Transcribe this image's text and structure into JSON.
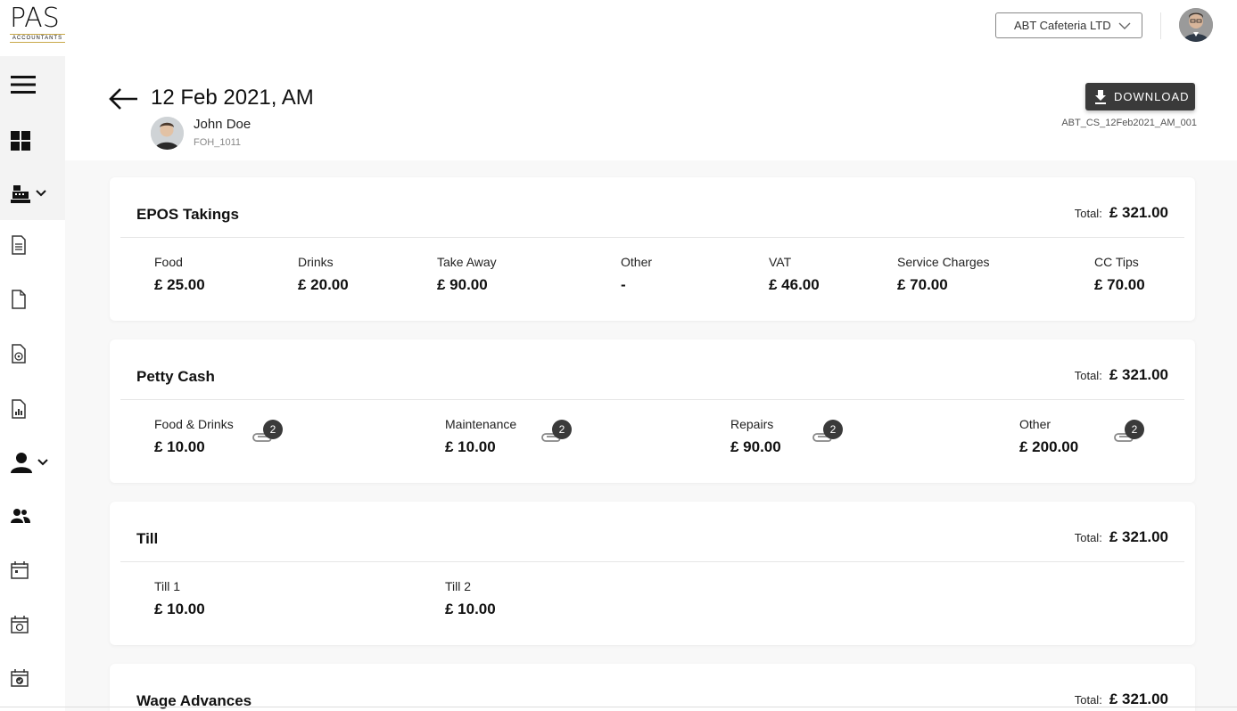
{
  "logo": {
    "text": "PAS",
    "sub": "ACCOUNTANTS"
  },
  "topbar": {
    "company": "ABT Cafeteria LTD"
  },
  "header": {
    "title": "12 Feb 2021, AM",
    "user_name": "John Doe",
    "user_code": "FOH_1011",
    "download_label": "DOWNLOAD",
    "doc_ref": "ABT_CS_12Feb2021_AM_001"
  },
  "sidebar": {
    "icons": [
      "menu-icon",
      "dashboard-icon",
      "cash-register-icon",
      "document-list-icon",
      "document-icon",
      "document-money-icon",
      "report-chart-icon",
      "user-icon",
      "users-icon",
      "calendar-icon",
      "calendar-clock-icon",
      "calendar-check-icon"
    ]
  },
  "epos": {
    "title": "EPOS Takings",
    "total_label": "Total:",
    "total": "£ 321.00",
    "fields": [
      {
        "label": "Food",
        "value": "£ 25.00"
      },
      {
        "label": "Drinks",
        "value": "£ 20.00"
      },
      {
        "label": "Take Away",
        "value": "£ 90.00"
      },
      {
        "label": "Other",
        "value": "-"
      },
      {
        "label": "VAT",
        "value": "£ 46.00"
      },
      {
        "label": "Service Charges",
        "value": "£ 70.00"
      },
      {
        "label": "CC Tips",
        "value": "£ 70.00"
      }
    ]
  },
  "petty": {
    "title": "Petty Cash",
    "total_label": "Total:",
    "total": "£ 321.00",
    "fields": [
      {
        "label": "Food & Drinks",
        "value": "£ 10.00",
        "attachments": "2"
      },
      {
        "label": "Maintenance",
        "value": "£ 10.00",
        "attachments": "2"
      },
      {
        "label": "Repairs",
        "value": "£ 90.00",
        "attachments": "2"
      },
      {
        "label": "Other",
        "value": "£ 200.00",
        "attachments": "2"
      }
    ]
  },
  "till": {
    "title": "Till",
    "total_label": "Total:",
    "total": "£ 321.00",
    "fields": [
      {
        "label": "Till 1",
        "value": "£ 10.00"
      },
      {
        "label": "Till 2",
        "value": "£ 10.00"
      }
    ]
  },
  "wage": {
    "title": "Wage Advances",
    "total_label": "Total:",
    "total": "£ 321.00"
  },
  "colors": {
    "accent": "#3a3a3a",
    "gold": "#c8a94a",
    "bg": "#f8f8f8"
  }
}
